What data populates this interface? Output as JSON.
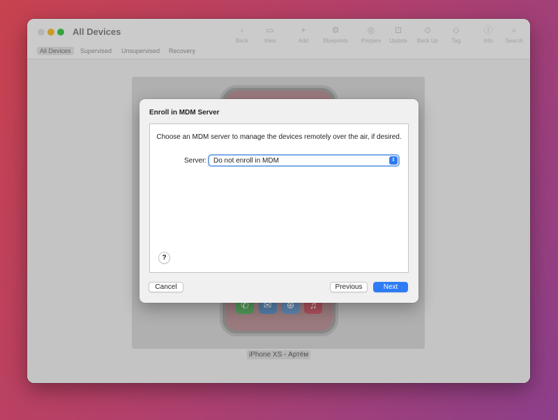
{
  "window": {
    "title": "All Devices"
  },
  "toolbar": {
    "items": [
      {
        "label": "Back",
        "icon": "chevron-left-icon",
        "glyph": "‹"
      },
      {
        "label": "View",
        "icon": "view-icon",
        "glyph": "▭"
      },
      {
        "label": "Add",
        "icon": "plus-icon",
        "glyph": "+"
      },
      {
        "label": "Blueprints",
        "icon": "blueprints-icon",
        "glyph": "⚙"
      },
      {
        "label": "Prepare",
        "icon": "prepare-icon",
        "glyph": "◎"
      },
      {
        "label": "Update",
        "icon": "update-icon",
        "glyph": "⊡"
      },
      {
        "label": "Back Up",
        "icon": "backup-icon",
        "glyph": "⊙"
      },
      {
        "label": "Tag",
        "icon": "tag-icon",
        "glyph": "◇"
      },
      {
        "label": "Info",
        "icon": "info-icon",
        "glyph": "ⓘ"
      },
      {
        "label": "Search",
        "icon": "search-icon",
        "glyph": "⌕"
      }
    ]
  },
  "tabs": [
    "All Devices",
    "Supervised",
    "Unsupervised",
    "Recovery"
  ],
  "device": {
    "name": "iPhone XS - Артём",
    "dock_icons": [
      "phone-app-icon",
      "mail-app-icon",
      "safari-app-icon",
      "music-app-icon"
    ]
  },
  "dialog": {
    "title": "Enroll in MDM Server",
    "description": "Choose an MDM server to manage the devices remotely over the air, if desired.",
    "server_label": "Server:",
    "server_value": "Do not enroll in MDM",
    "help": "?",
    "cancel_label": "Cancel",
    "previous_label": "Previous",
    "next_label": "Next"
  },
  "colors": {
    "accent": "#2f7bf5",
    "close": "#d0d0d0",
    "minimize": "#e5b132",
    "maximize": "#3fbb4a"
  }
}
